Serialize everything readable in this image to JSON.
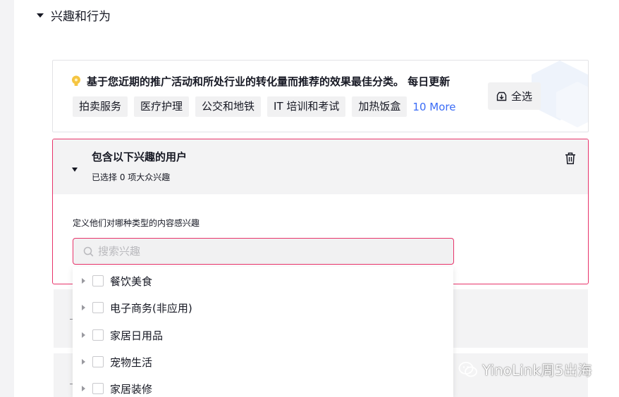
{
  "section": {
    "title": "兴趣和行为"
  },
  "recommendation": {
    "title": "基于您近期的推广活动和所处行业的转化量而推荐的效果最佳分类。 每日更新",
    "tags": [
      "拍卖服务",
      "医疗护理",
      "公交和地铁",
      "IT 培训和考试",
      "加热饭盒"
    ],
    "more_label": "10 More",
    "select_all_label": "全选",
    "icon": "lightbulb-icon",
    "accent_color": "#f5c542"
  },
  "include_panel": {
    "title": "包含以下兴趣的用户",
    "subtitle": "已选择 0 项大众兴趣",
    "define_label": "定义他们对哪种类型的内容感兴趣",
    "search_placeholder": "搜索兴趣",
    "border_color": "#e8336a",
    "delete_icon": "trash-icon"
  },
  "dropdown": {
    "items": [
      {
        "label": "餐饮美食"
      },
      {
        "label": "电子商务(非应用)"
      },
      {
        "label": "家居日用品"
      },
      {
        "label": "宠物生活"
      },
      {
        "label": "家居装修"
      }
    ]
  },
  "watermark": {
    "text": "YinoLink周5出海",
    "icon": "wechat-icon"
  },
  "colors": {
    "link": "#3b6cf6",
    "tag_bg": "#f1f1f2",
    "text": "#161823"
  }
}
